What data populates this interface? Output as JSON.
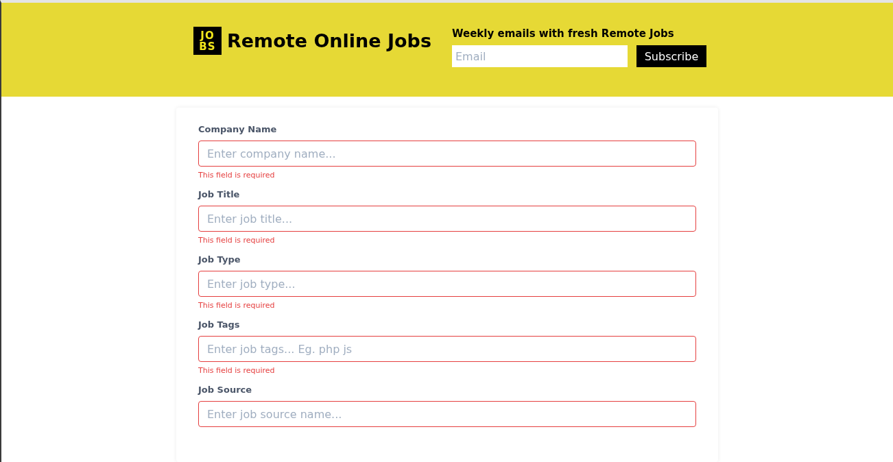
{
  "header": {
    "logo": [
      "JO",
      "BS"
    ],
    "site_title": "Remote Online Jobs",
    "newsletter": {
      "heading": "Weekly emails with fresh Remote Jobs",
      "email": {
        "placeholder": "Email"
      },
      "button": "Subscribe"
    }
  },
  "form": {
    "fields": [
      {
        "label": "Company Name",
        "placeholder": "Enter company name...",
        "invalid": true,
        "error": "This field is required"
      },
      {
        "label": "Job Title",
        "placeholder": "Enter job title...",
        "invalid": true,
        "error": "This field is required"
      },
      {
        "label": "Job Type",
        "placeholder": "Enter job type...",
        "invalid": true,
        "error": "This field is required"
      },
      {
        "label": "Job Tags",
        "placeholder": "Enter job tags... Eg. php js",
        "invalid": true,
        "error": "This field is required"
      },
      {
        "label": "Job Source",
        "placeholder": "Enter job source name...",
        "invalid": true
      }
    ]
  }
}
